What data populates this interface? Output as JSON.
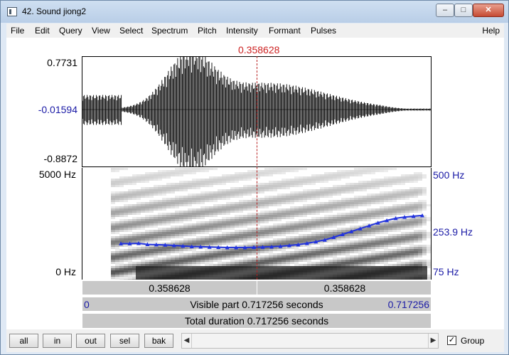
{
  "window": {
    "title": "42. Sound jiong2"
  },
  "menu": {
    "items": [
      "File",
      "Edit",
      "Query",
      "View",
      "Select",
      "Spectrum",
      "Pitch",
      "Intensity",
      "Formant",
      "Pulses"
    ],
    "help": "Help"
  },
  "cursor": {
    "time": "0.358628"
  },
  "waveform": {
    "max": "0.7731",
    "cursor_value": "-0.01594",
    "min": "-0.8872"
  },
  "spectrogram": {
    "freq_top": "5000 Hz",
    "freq_bottom": "0 Hz",
    "pitch_top": "500 Hz",
    "pitch_mid": "253.9 Hz",
    "pitch_bottom": "75 Hz"
  },
  "selection": {
    "left_duration": "0.358628",
    "right_duration": "0.358628"
  },
  "visible": {
    "start": "0",
    "label": "Visible part 0.717256 seconds",
    "end": "0.717256"
  },
  "total": {
    "label": "Total duration 0.717256 seconds"
  },
  "buttons": {
    "all": "all",
    "in": "in",
    "out": "out",
    "sel": "sel",
    "bak": "bak"
  },
  "group": {
    "label": "Group",
    "checked": true
  },
  "colors": {
    "cursor": "#cc2020",
    "pitch": "#1a1aa6",
    "pitch_marks": "#2233dd"
  },
  "pitch_contour_hz": [
    212,
    212,
    213,
    209,
    208,
    207,
    205,
    203,
    201,
    200,
    199,
    198,
    197,
    197,
    197,
    198,
    199,
    200,
    202,
    205,
    208,
    213,
    219,
    226,
    236,
    247,
    258,
    269,
    280,
    291,
    300,
    308,
    313,
    316,
    319
  ]
}
